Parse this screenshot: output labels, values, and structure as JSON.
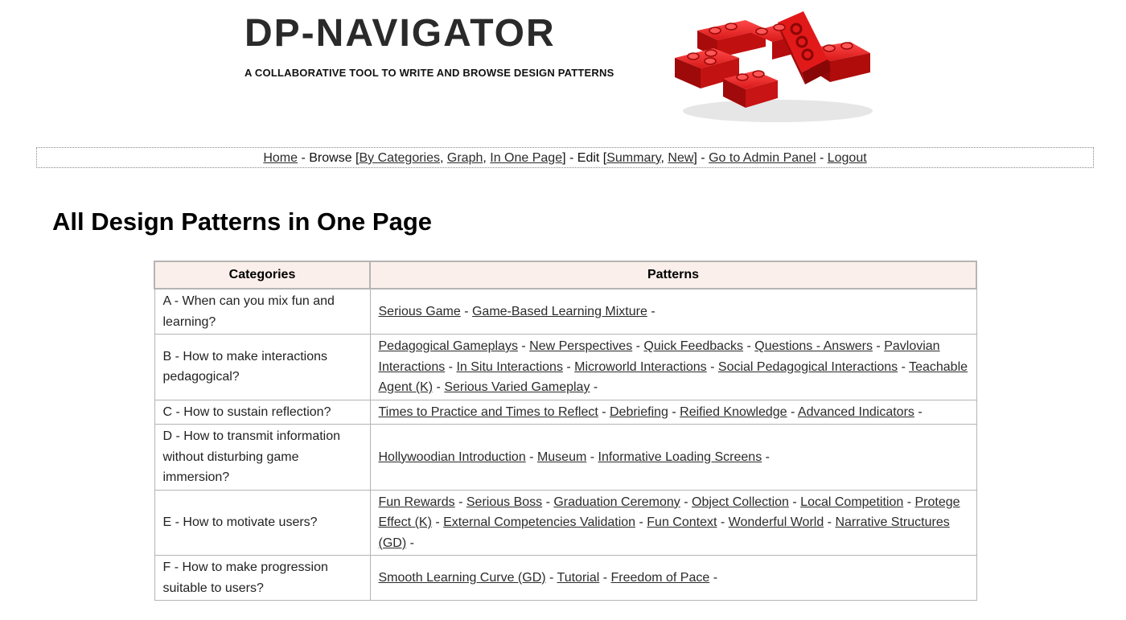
{
  "header": {
    "title": "DP-NAVIGATOR",
    "tagline": "A COLLABORATIVE TOOL TO WRITE AND BROWSE DESIGN PATTERNS",
    "logo_icon": "red-lego-bricks-logo"
  },
  "nav": {
    "home": "Home",
    "browse_label": "Browse",
    "by_categories": "By Categories",
    "graph": "Graph",
    "in_one_page": "In One Page",
    "edit_label": "Edit",
    "summary": "Summary",
    "new": "New",
    "admin_panel": "Go to Admin Panel",
    "logout": "Logout"
  },
  "page": {
    "heading": "All Design Patterns in One Page"
  },
  "table": {
    "headers": {
      "categories": "Categories",
      "patterns": "Patterns"
    },
    "rows": [
      {
        "category": "A - When can you mix fun and learning?",
        "patterns": [
          "Serious Game",
          "Game-Based Learning Mixture"
        ]
      },
      {
        "category": "B - How to make interactions pedagogical?",
        "patterns": [
          "Pedagogical Gameplays",
          "New Perspectives",
          "Quick Feedbacks",
          "Questions - Answers",
          "Pavlovian Interactions",
          "In Situ Interactions",
          "Microworld Interactions",
          "Social Pedagogical Interactions",
          "Teachable Agent (K)",
          "Serious Varied Gameplay"
        ]
      },
      {
        "category": "C - How to sustain reflection?",
        "patterns": [
          "Times to Practice and Times to Reflect",
          "Debriefing",
          "Reified Knowledge",
          "Advanced Indicators"
        ]
      },
      {
        "category": "D - How to transmit information without disturbing game immersion?",
        "patterns": [
          "Hollywoodian Introduction",
          "Museum",
          "Informative Loading Screens"
        ]
      },
      {
        "category": "E - How to motivate users?",
        "patterns": [
          "Fun Rewards",
          "Serious Boss",
          "Graduation Ceremony",
          "Object Collection",
          "Local Competition",
          "Protege Effect (K)",
          "External Competencies Validation",
          "Fun Context",
          "Wonderful World",
          "Narrative Structures (GD)"
        ]
      },
      {
        "category": "F - How to make progression suitable to users?",
        "patterns": [
          "Smooth Learning Curve (GD)",
          "Tutorial",
          "Freedom of Pace"
        ]
      }
    ]
  },
  "colors": {
    "header_row_bg": "#fbefeb",
    "border": "#b4b4b4",
    "brick_red": "#d41414"
  }
}
